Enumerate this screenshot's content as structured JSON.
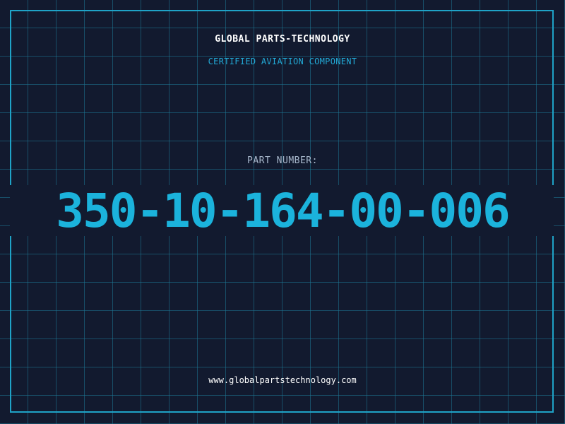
{
  "header": {
    "company": "GLOBAL PARTS-TECHNOLOGY",
    "subtitle": "CERTIFIED AVIATION COMPONENT"
  },
  "part": {
    "label": "PART NUMBER:",
    "number": "350-10-164-00-006"
  },
  "footer": {
    "website": "www.globalpartstechnology.com"
  },
  "colors": {
    "background": "#121a2f",
    "grid": "#1e7896",
    "accent": "#1bb3dc",
    "frame": "#1fa3c7",
    "text": "#ffffff",
    "label": "#a8b8cc"
  }
}
